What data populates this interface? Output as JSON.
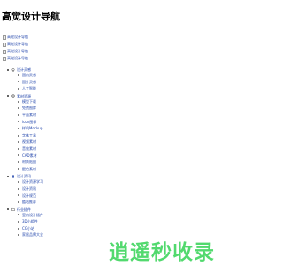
{
  "page": {
    "title": "高觉设计导航"
  },
  "logos": [
    "高觉设计导航",
    "高觉设计导航",
    "高觉设计导航",
    "高觉设计导航"
  ],
  "nav": [
    {
      "label": "设计灵感",
      "items": [
        "国内灵感",
        "国外灵感",
        "人工智能"
      ]
    },
    {
      "label": "素材资源",
      "items": [
        "模型下载",
        "免费图库",
        "平面素材",
        "icon图标",
        "样机Mockup",
        "字体工具",
        "视频素材",
        "音效素材",
        "CAD素材",
        "材质贴图",
        "配色素材"
      ]
    },
    {
      "label": "设计资讯",
      "items": [
        "设计资源学习",
        "设计资讯",
        "设计规范",
        "酷站推荐"
      ]
    },
    {
      "label": "行业插件",
      "items": [
        "室内设计插件",
        "3D小组件",
        "CG小站",
        "家居品牌大全"
      ]
    }
  ],
  "watermark": "逍遥秒收录",
  "colors": {
    "link": "#1a3fa8",
    "watermark": "#52d96e"
  }
}
